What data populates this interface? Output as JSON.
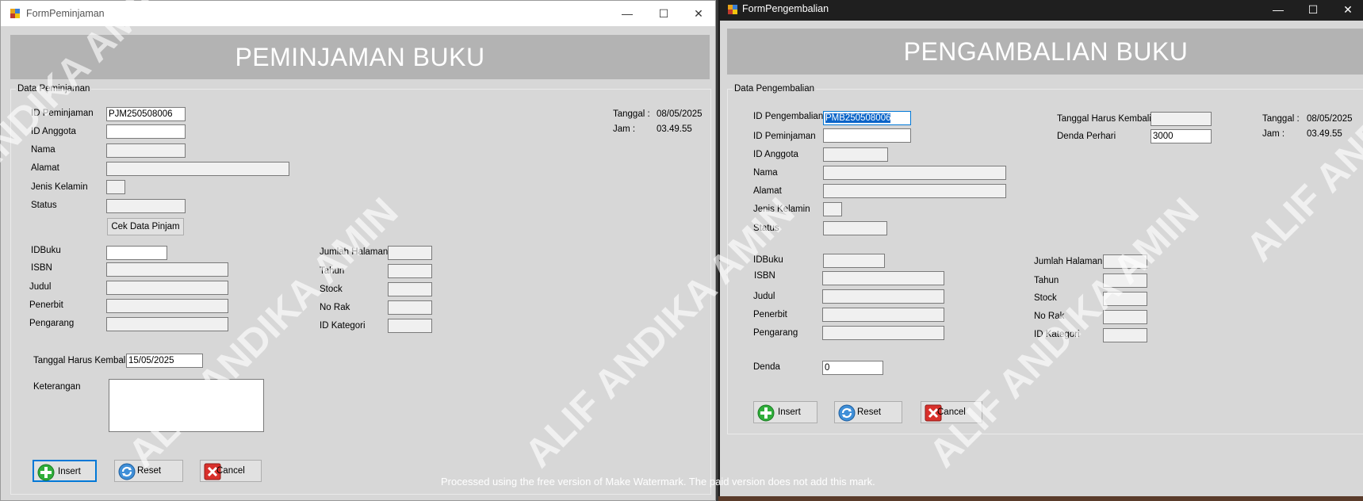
{
  "peminjaman": {
    "window_title": "FormPeminjaman",
    "controls": {
      "minimize": "—",
      "maximize": "☐",
      "close": "✕"
    },
    "banner": "PEMINJAMAN BUKU",
    "group_label": "Data Peminjaman",
    "tanggal_label": "Tanggal :",
    "tanggal_value": "08/05/2025",
    "jam_label": "Jam :",
    "jam_value": "03.49.55",
    "labels": {
      "id_peminjaman": "ID Peminjaman",
      "id_anggota": "ID Anggota",
      "nama": "Nama",
      "alamat": "Alamat",
      "jenis_kelamin": "Jenis Kelamin",
      "status": "Status",
      "idbuku": "IDBuku",
      "isbn": "ISBN",
      "judul": "Judul",
      "penerbit": "Penerbit",
      "pengarang": "Pengarang",
      "jumlah_halaman": "Jumlah Halaman",
      "tahun": "Tahun",
      "stock": "Stock",
      "no_rak": "No Rak",
      "id_kategori": "ID Kategori",
      "tanggal_harus_kembali": "Tanggal Harus Kembali",
      "keterangan": "Keterangan"
    },
    "values": {
      "id_peminjaman": "PJM250508006",
      "tanggal_harus_kembali": "15/05/2025"
    },
    "buttons": {
      "cek_data_pinjam": "Cek Data Pinjam",
      "insert": "Insert",
      "reset": "Reset",
      "cancel": "Cancel"
    }
  },
  "pengembalian": {
    "window_title": "FormPengembalian",
    "controls": {
      "minimize": "—",
      "maximize": "☐",
      "close": "✕"
    },
    "banner": "PENGAMBALIAN BUKU",
    "group_label": "Data Pengembalian",
    "tanggal_label": "Tanggal :",
    "tanggal_value": "08/05/2025",
    "jam_label": "Jam :",
    "jam_value": "03.49.55",
    "labels": {
      "id_pengembalian": "ID Pengembalian",
      "id_peminjaman": "ID Peminjaman",
      "id_anggota": "ID Anggota",
      "nama": "Nama",
      "alamat": "Alamat",
      "jenis_kelamin": "Jenis Kelamin",
      "status": "Status",
      "tanggal_harus_kembali": "Tanggal Harus Kembali",
      "denda_perhari": "Denda Perhari",
      "idbuku": "IDBuku",
      "isbn": "ISBN",
      "judul": "Judul",
      "penerbit": "Penerbit",
      "pengarang": "Pengarang",
      "jumlah_halaman": "Jumlah Halaman",
      "tahun": "Tahun",
      "stock": "Stock",
      "no_rak": "No Rak",
      "id_kategori": "ID Kategori",
      "denda": "Denda"
    },
    "values": {
      "id_pengembalian": "PMB250508006",
      "denda_perhari": "3000",
      "denda": "0"
    },
    "buttons": {
      "insert": "Insert",
      "reset": "Reset",
      "cancel": "Cancel"
    }
  },
  "watermark": {
    "text": "ALIF ANDIKA AMIN",
    "footer": "Processed using the free version of Make Watermark. The paid version does not add this mark."
  }
}
